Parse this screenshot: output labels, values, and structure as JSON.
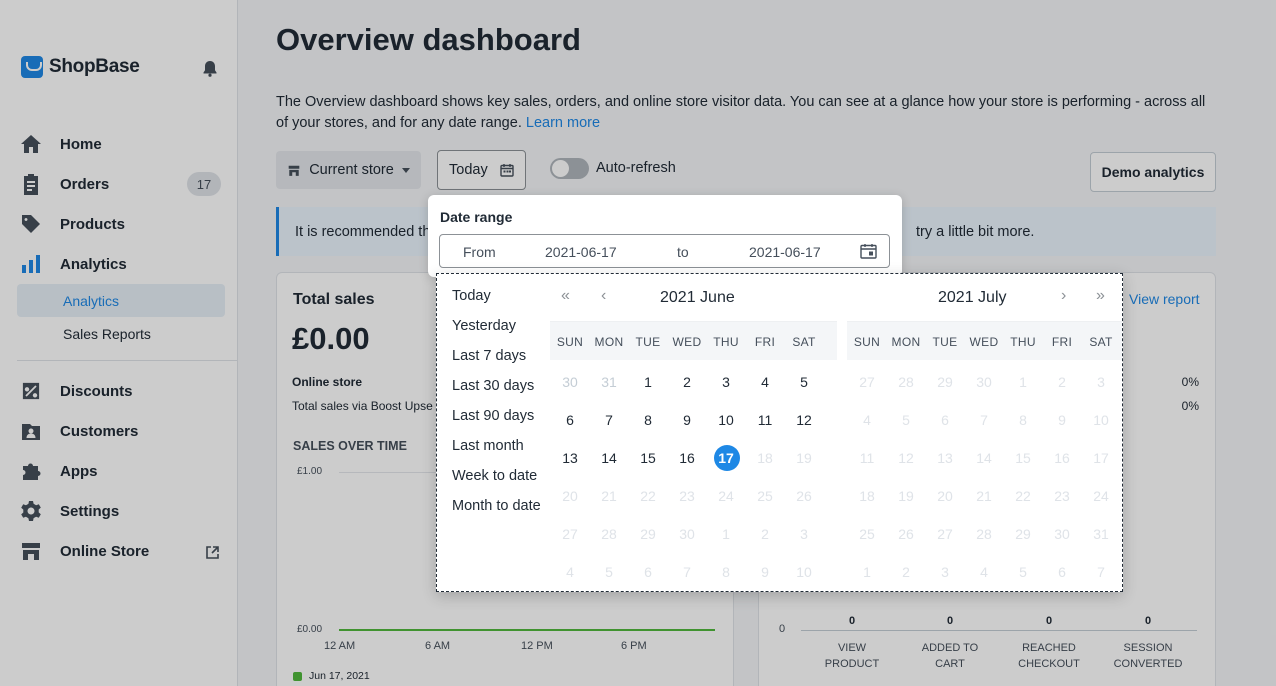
{
  "app": {
    "name": "ShopBase"
  },
  "sidebar": {
    "items": [
      {
        "label": "Home",
        "icon": "home-icon"
      },
      {
        "label": "Orders",
        "icon": "orders-icon",
        "badge": "17"
      },
      {
        "label": "Products",
        "icon": "tag-icon"
      },
      {
        "label": "Analytics",
        "icon": "bar-chart-icon"
      },
      {
        "label": "Discounts",
        "icon": "discount-icon"
      },
      {
        "label": "Customers",
        "icon": "customers-icon"
      },
      {
        "label": "Apps",
        "icon": "puzzle-icon"
      },
      {
        "label": "Settings",
        "icon": "gear-icon"
      },
      {
        "label": "Online Store",
        "icon": "store-icon"
      }
    ],
    "analytics_sub": [
      "Analytics",
      "Sales Reports"
    ]
  },
  "header": {
    "title": "Overview dashboard",
    "description": "The Overview dashboard shows key sales, orders, and online store visitor data. You can see at a glance how your store is performing - across all of your stores, and for any date range.",
    "learn_more": "Learn more"
  },
  "toolbar": {
    "store_label": "Current store",
    "date_label": "Today",
    "auto_refresh_label": "Auto-refresh",
    "demo_label": "Demo analytics"
  },
  "banner": {
    "text_left": "It is recommended tha",
    "text_right": "try a little bit more."
  },
  "sales_card": {
    "title": "Total sales",
    "value": "£0.00",
    "online_store": "Online store",
    "boost_upsell": "Total sales via Boost Upse",
    "sales_over_time": "SALES OVER TIME",
    "y_top": "£1.00",
    "y_bottom": "£0.00",
    "x_ticks": [
      "12 AM",
      "6 AM",
      "12 PM",
      "6 PM"
    ],
    "legend": "Jun 17, 2021"
  },
  "conversion_card": {
    "view_report": "View report",
    "pct_1": "0%",
    "pct_2": "0%",
    "axis_zero": "0",
    "funnel": [
      {
        "value": "0",
        "label_1": "VIEW",
        "label_2": "PRODUCT"
      },
      {
        "value": "0",
        "label_1": "ADDED TO",
        "label_2": "CART"
      },
      {
        "value": "0",
        "label_1": "REACHED",
        "label_2": "CHECKOUT"
      },
      {
        "value": "0",
        "label_1": "SESSION",
        "label_2": "CONVERTED"
      }
    ]
  },
  "date_range": {
    "title": "Date range",
    "from_label": "From",
    "from_value": "2021-06-17",
    "to_label": "to",
    "to_value": "2021-06-17"
  },
  "presets": [
    "Today",
    "Yesterday",
    "Last 7 days",
    "Last 30 days",
    "Last 90 days",
    "Last month",
    "Week to date",
    "Month to date"
  ],
  "calendar": {
    "weekdays": [
      "SUN",
      "MON",
      "TUE",
      "WED",
      "THU",
      "FRI",
      "SAT"
    ],
    "left": {
      "title": "2021 June",
      "weeks": [
        [
          "30",
          "31",
          "1",
          "2",
          "3",
          "4",
          "5"
        ],
        [
          "6",
          "7",
          "8",
          "9",
          "10",
          "11",
          "12"
        ],
        [
          "13",
          "14",
          "15",
          "16",
          "17",
          "18",
          "19"
        ],
        [
          "20",
          "21",
          "22",
          "23",
          "24",
          "25",
          "26"
        ],
        [
          "27",
          "28",
          "29",
          "30",
          "1",
          "2",
          "3"
        ],
        [
          "4",
          "5",
          "6",
          "7",
          "8",
          "9",
          "10"
        ]
      ],
      "selected": "17"
    },
    "right": {
      "title": "2021 July",
      "weeks": [
        [
          "27",
          "28",
          "29",
          "30",
          "1",
          "2",
          "3"
        ],
        [
          "4",
          "5",
          "6",
          "7",
          "8",
          "9",
          "10"
        ],
        [
          "11",
          "12",
          "13",
          "14",
          "15",
          "16",
          "17"
        ],
        [
          "18",
          "19",
          "20",
          "21",
          "22",
          "23",
          "24"
        ],
        [
          "25",
          "26",
          "27",
          "28",
          "29",
          "30",
          "31"
        ],
        [
          "1",
          "2",
          "3",
          "4",
          "5",
          "6",
          "7"
        ]
      ]
    },
    "nav": {
      "prev_year": "«",
      "prev_month": "‹",
      "next_month": "›",
      "next_year": "»"
    }
  },
  "colors": {
    "accent": "#1e88e5",
    "series": "#50b83c"
  }
}
